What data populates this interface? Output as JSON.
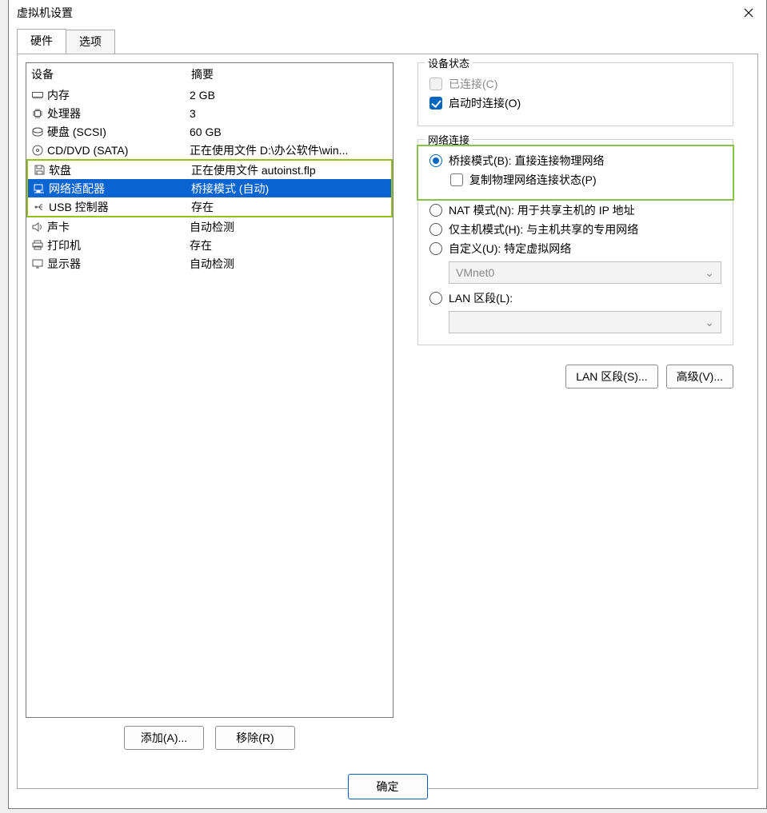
{
  "window": {
    "title": "虚拟机设置"
  },
  "tabs": {
    "hardware": "硬件",
    "options": "选项"
  },
  "headers": {
    "device": "设备",
    "summary": "摘要"
  },
  "rows": {
    "memory": {
      "name": "内存",
      "summary": "2 GB"
    },
    "cpu": {
      "name": "处理器",
      "summary": "3"
    },
    "hdd": {
      "name": "硬盘 (SCSI)",
      "summary": "60 GB"
    },
    "cd": {
      "name": "CD/DVD (SATA)",
      "summary": "正在使用文件 D:\\办公软件\\win..."
    },
    "floppy": {
      "name": "软盘",
      "summary": "正在使用文件 autoinst.flp"
    },
    "net": {
      "name": "网络适配器",
      "summary": "桥接模式 (自动)"
    },
    "usb": {
      "name": "USB 控制器",
      "summary": "存在"
    },
    "sound": {
      "name": "声卡",
      "summary": "自动检测"
    },
    "printer": {
      "name": "打印机",
      "summary": "存在"
    },
    "display": {
      "name": "显示器",
      "summary": "自动检测"
    }
  },
  "leftButtons": {
    "add": "添加(A)...",
    "remove": "移除(R)"
  },
  "deviceStatus": {
    "legend": "设备状态",
    "connected": "已连接(C)",
    "connectAtPowerOn": "启动时连接(O)"
  },
  "netConn": {
    "legend": "网络连接",
    "bridged": "桥接模式(B): 直接连接物理网络",
    "replicate": "复制物理网络连接状态(P)",
    "nat": "NAT 模式(N): 用于共享主机的 IP 地址",
    "hostOnly": "仅主机模式(H): 与主机共享的专用网络",
    "custom": "自定义(U): 特定虚拟网络",
    "vmnet": "VMnet0",
    "lan": "LAN 区段(L):"
  },
  "rightButtons": {
    "lanSegments": "LAN 区段(S)...",
    "advanced": "高级(V)..."
  },
  "footer": {
    "ok": "确定"
  }
}
